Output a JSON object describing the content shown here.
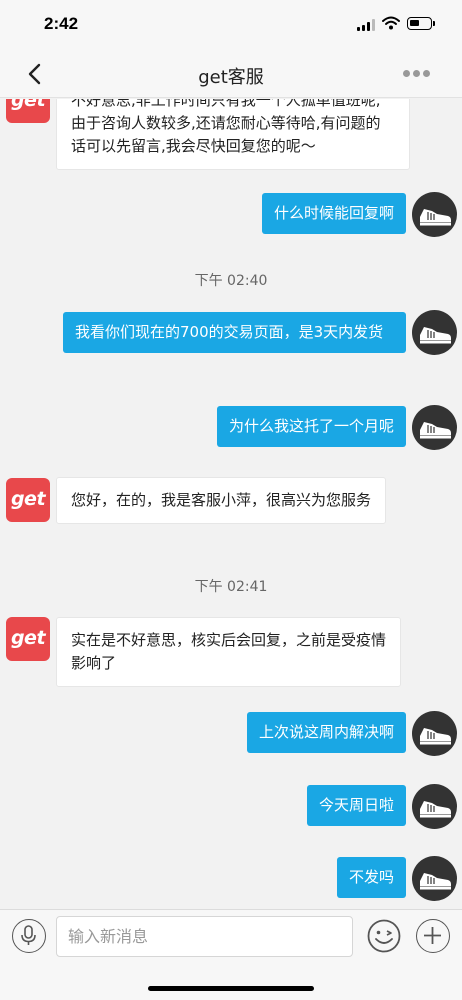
{
  "status_bar": {
    "time": "2:42"
  },
  "nav": {
    "title": "get客服"
  },
  "messages": {
    "m1": {
      "text": "不好意思,非工作时间只有我一个人孤单值班呢,由于咨询人数较多,还请您耐心等待哈,有问题的话可以先留言,我会尽快回复您的呢～"
    },
    "m2": {
      "text": "什么时候能回复啊"
    },
    "t1": {
      "text": "下午 02:40"
    },
    "m3": {
      "text": "我看你们现在的700的交易页面，是3天内发货"
    },
    "m4": {
      "text": "为什么我这托了一个月呢"
    },
    "m5": {
      "text": "您好，在的，我是客服小萍，很高兴为您服务"
    },
    "t2": {
      "text": "下午 02:41"
    },
    "m6": {
      "text": "实在是不好意思，核实后会回复，之前是受疫情影响了"
    },
    "m7": {
      "text": "上次说这周内解决啊"
    },
    "m8": {
      "text": "今天周日啦"
    },
    "m9": {
      "text": "不发吗"
    }
  },
  "avatars": {
    "agent_label": "get"
  },
  "input_bar": {
    "placeholder": "输入新消息"
  },
  "colors": {
    "bubble_self": "#1aa7e4",
    "brand_red": "#e8484b",
    "background": "#f2f2f2"
  },
  "icons": [
    "back-icon",
    "more-icon",
    "voice-icon",
    "emoji-icon",
    "plus-icon",
    "signal-icon",
    "wifi-icon",
    "battery-icon"
  ]
}
